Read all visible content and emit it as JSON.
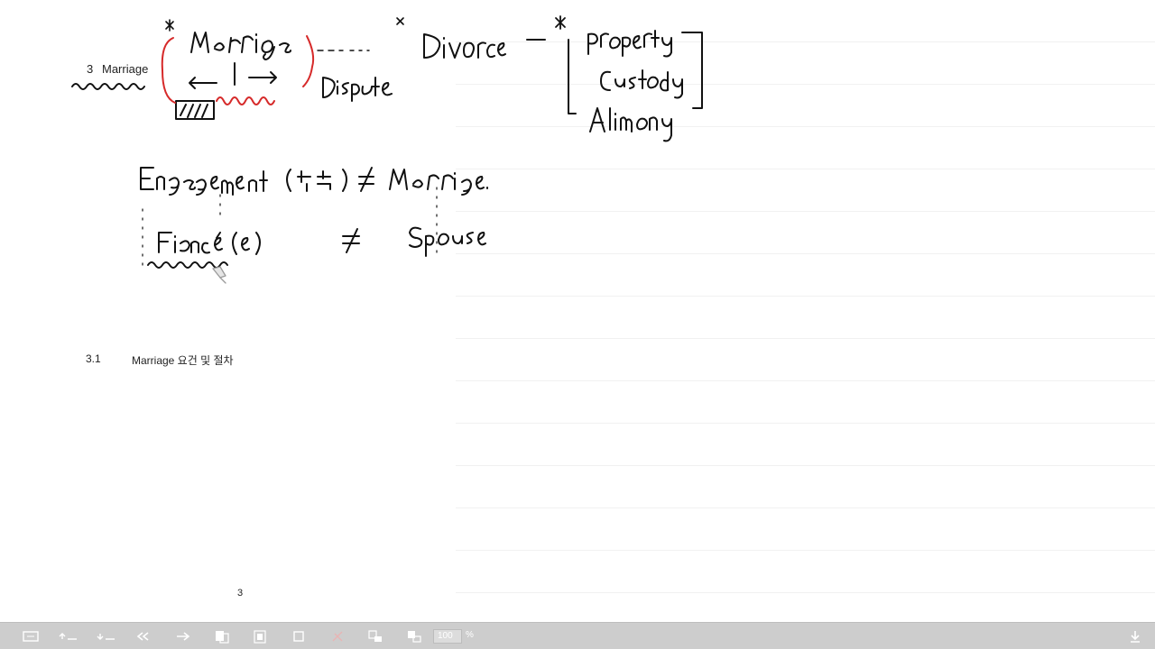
{
  "document": {
    "heading_number": "3",
    "heading_title": "Marriage",
    "subsection_number": "3.1",
    "subsection_title": "Marriage 요건 및 절차",
    "page_number": "3"
  },
  "toolbar": {
    "zoom_value": "100",
    "zoom_unit": "%",
    "buttons": [
      {
        "name": "fit-page-icon"
      },
      {
        "name": "previous-page-icon"
      },
      {
        "name": "next-page-icon"
      },
      {
        "name": "undo-icon"
      },
      {
        "name": "redo-icon"
      },
      {
        "name": "copy-icon"
      },
      {
        "name": "paste-icon"
      },
      {
        "name": "select-icon"
      },
      {
        "name": "delete-icon"
      },
      {
        "name": "zoom-in-icon"
      },
      {
        "name": "zoom-out-icon"
      },
      {
        "name": "download-icon"
      }
    ]
  },
  "colors": {
    "ink": "#111111",
    "highlight_ink": "#d62a2a",
    "toolbar_bg": "#cdcdcd",
    "toolbar_icon": "#ffffff"
  }
}
